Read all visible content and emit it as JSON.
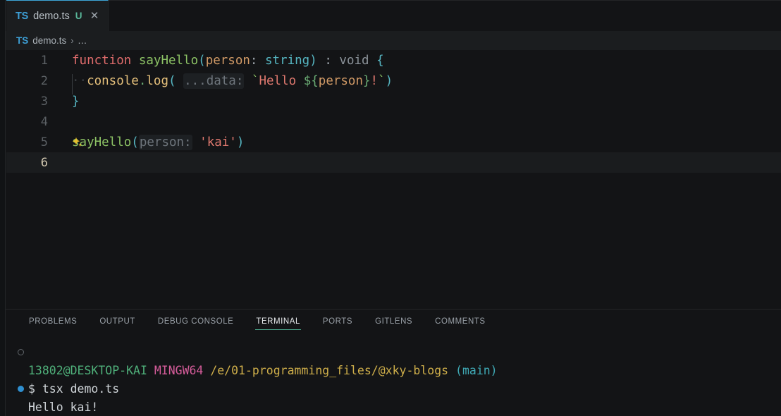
{
  "window": {
    "app": "Visual Studio Code",
    "theme_bg": "#131416",
    "accent": "#3da6d8"
  },
  "tabbar": {
    "tabs": [
      {
        "icon_label": "TS",
        "name": "demo.ts",
        "badge": "U",
        "close_glyph": "✕",
        "active": true
      }
    ]
  },
  "breadcrumb": {
    "icon_label": "TS",
    "file": "demo.ts",
    "separator": "›",
    "overflow": "..."
  },
  "editor": {
    "language": "typescript",
    "active_line": 6,
    "lines": [
      {
        "number": "1",
        "active": false
      },
      {
        "number": "2",
        "active": false
      },
      {
        "number": "3",
        "active": false
      },
      {
        "number": "4",
        "active": false
      },
      {
        "number": "5",
        "active": false
      },
      {
        "number": "6",
        "active": true
      }
    ],
    "line1": {
      "kw_function": "function",
      "space1": " ",
      "fn_name": "sayHello",
      "paren_open": "(",
      "param": "person",
      "colon1": ":",
      "space2": " ",
      "type": "string",
      "paren_close": ")",
      "space3": " ",
      "colon2": ":",
      "space4": " ",
      "return_type": "void",
      "space5": " ",
      "brace_open": "{"
    },
    "line2": {
      "ws_dots": "··",
      "obj": "console",
      "dot": ".",
      "method": "log",
      "paren_open": "(",
      "space1": " ",
      "inlay_hint": "...data:",
      "space2": " ",
      "tick_open": "`",
      "text": "Hello ",
      "interp_open": "${",
      "interp_var": "person",
      "interp_close": "}",
      "bang": "!",
      "tick_close": "`",
      "paren_close": ")"
    },
    "line3": {
      "brace_close": "}"
    },
    "line4": {
      "empty": ""
    },
    "line5": {
      "suggest_icon": "sparkle-icon",
      "fn_name": "sayHello",
      "paren_open": "(",
      "inlay_hint": "person:",
      "space1": " ",
      "string_literal": "'kai'",
      "paren_close": ")"
    },
    "line6": {
      "empty": ""
    }
  },
  "panel": {
    "tabs": [
      {
        "label": "PROBLEMS",
        "active": false
      },
      {
        "label": "OUTPUT",
        "active": false
      },
      {
        "label": "DEBUG CONSOLE",
        "active": false
      },
      {
        "label": "TERMINAL",
        "active": true
      },
      {
        "label": "PORTS",
        "active": false
      },
      {
        "label": "GITLENS",
        "active": false
      },
      {
        "label": "COMMENTS",
        "active": false
      }
    ],
    "active_tab": "TERMINAL"
  },
  "terminal": {
    "prompt": {
      "user_host": "13802@DESKTOP-KAI",
      "space1": " ",
      "shell": "MINGW64",
      "space2": " ",
      "path": "/e/01-programming_files/@xky-blogs",
      "space3": " ",
      "branch": "(main)"
    },
    "command_line": {
      "sigil": "$",
      "space": " ",
      "command": "tsx demo.ts"
    },
    "output_lines": [
      "Hello kai!"
    ],
    "decorations": {
      "pending": "command-decoration-ring",
      "success": "command-decoration-dot"
    }
  }
}
